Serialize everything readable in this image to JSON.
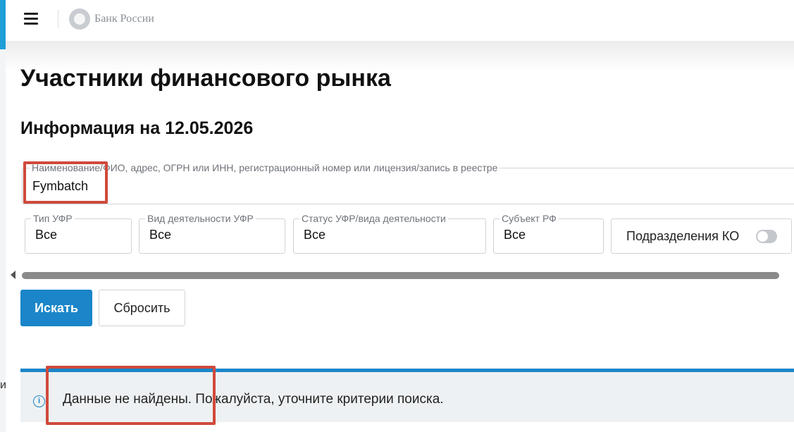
{
  "header": {
    "bank_name": "Банк России",
    "menu_icon": "hamburger-icon",
    "logo_icon": "bank-emblem-icon"
  },
  "page": {
    "title": "Участники финансового рынка",
    "info_heading": "Информация на 12.05.2026",
    "edge_letter": "и"
  },
  "search": {
    "label": "Наименование/ФИО, адрес, ОГРН или ИНН, регистрационный номер или лицензия/запись в реестре",
    "value": "Fymbatch"
  },
  "filters": [
    {
      "label": "Тип УФР",
      "value": "Все"
    },
    {
      "label": "Вид деятельности УФР",
      "value": "Все"
    },
    {
      "label": "Статус УФР/вида деятельности",
      "value": "Все"
    },
    {
      "label": "Субъект РФ",
      "value": "Все"
    }
  ],
  "toggle": {
    "label": "Подразделения КО",
    "on": false
  },
  "buttons": {
    "search": "Искать",
    "reset": "Сбросить"
  },
  "alert": {
    "icon": "info-icon",
    "message": "Данные не найдены. Пожалуйста, уточните критерии поиска."
  },
  "colors": {
    "accent": "#1a86c9",
    "highlight": "#cf4a3c",
    "alert_bg": "#eef1f3"
  }
}
